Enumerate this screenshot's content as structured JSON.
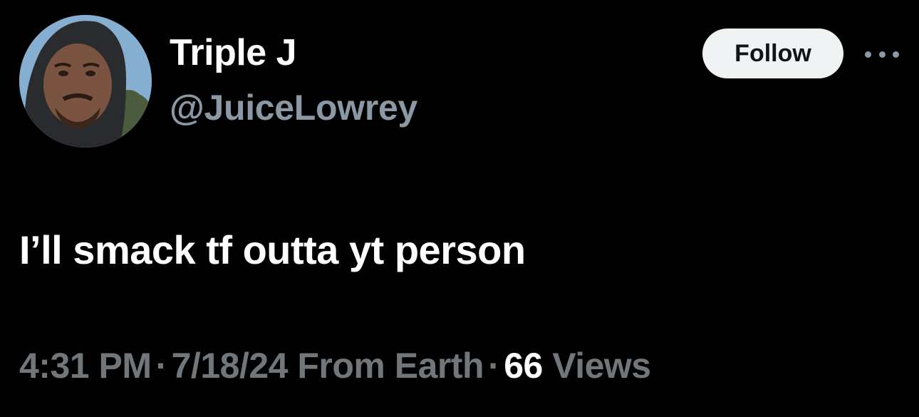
{
  "author": {
    "display_name": "Triple J",
    "handle": "@JuiceLowrey"
  },
  "actions": {
    "follow_label": "Follow"
  },
  "tweet": {
    "text": "I’ll smack tf outta yt person"
  },
  "meta": {
    "time": "4:31 PM",
    "separator": "·",
    "date": "7/18/24",
    "source": "From Earth",
    "views_count": "66",
    "views_label": "Views"
  },
  "icons": {
    "more": "more-horizontal-icon",
    "avatar": "profile-photo"
  },
  "colors": {
    "background": "#000000",
    "primary_text": "#ffffff",
    "secondary_text": "#71767b",
    "follow_bg": "#eff3f4",
    "follow_text": "#0f1419"
  }
}
